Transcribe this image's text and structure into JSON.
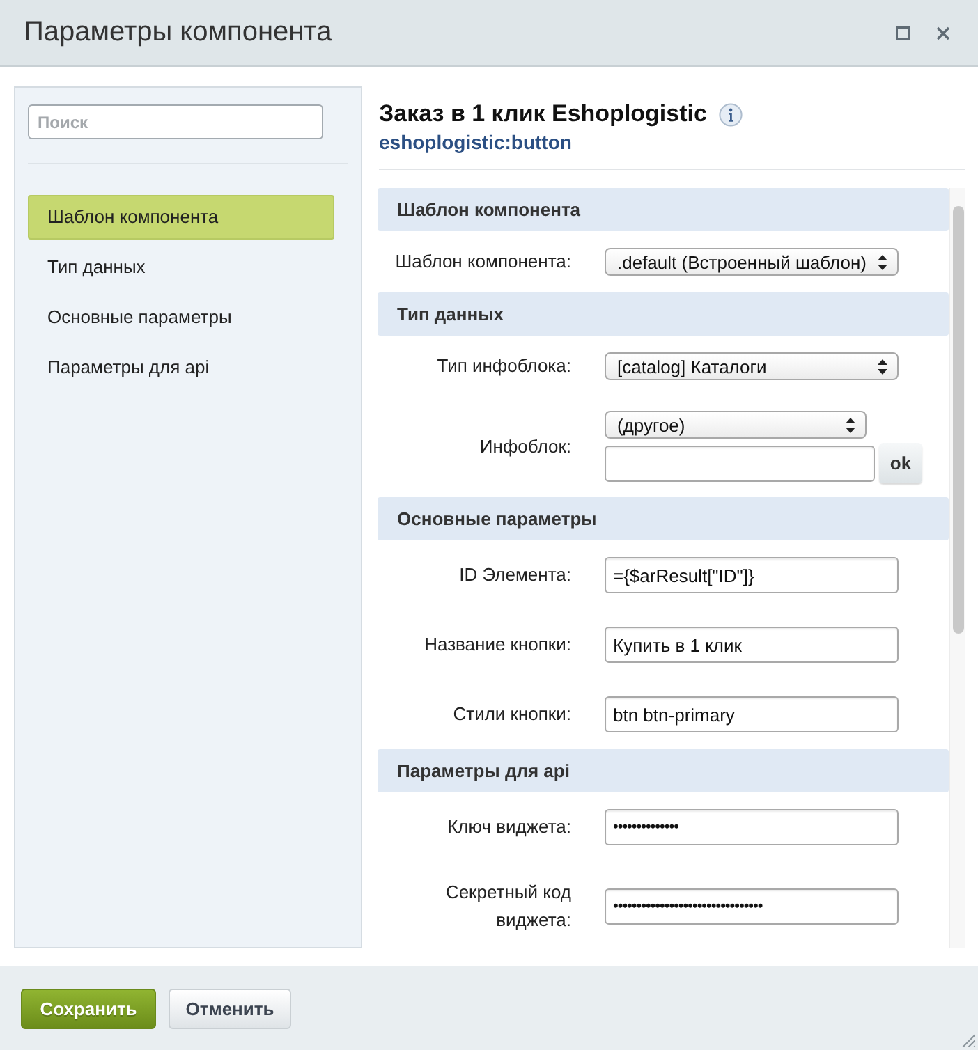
{
  "window": {
    "title": "Параметры компонента"
  },
  "sidebar": {
    "search": {
      "placeholder": "Поиск"
    },
    "items": [
      {
        "label": "Шаблон компонента",
        "selected": true
      },
      {
        "label": "Тип данных",
        "selected": false
      },
      {
        "label": "Основные параметры",
        "selected": false
      },
      {
        "label": "Параметры для api",
        "selected": false
      }
    ]
  },
  "component": {
    "title": "Заказ в 1 клик Eshoplogistic",
    "code": "eshoplogistic:button"
  },
  "sections": [
    {
      "title": "Шаблон компонента",
      "fields": [
        {
          "kind": "select",
          "label": "Шаблон компонента:",
          "value": ".default (Встроенный шаблон)"
        }
      ]
    },
    {
      "title": "Тип данных",
      "fields": [
        {
          "kind": "select",
          "label": "Тип инфоблока:",
          "value": "[catalog] Каталоги"
        },
        {
          "kind": "select_other",
          "label": "Инфоблок:",
          "value": "(другое)",
          "button": "ok"
        }
      ]
    },
    {
      "title": "Основные параметры",
      "fields": [
        {
          "kind": "text",
          "label": "ID Элемента:",
          "value": "={$arResult[\"ID\"]}"
        },
        {
          "kind": "text",
          "label": "Название кнопки:",
          "value": "Купить в 1 клик"
        },
        {
          "kind": "text",
          "label": "Стили кнопки:",
          "value": "btn btn-primary"
        }
      ]
    },
    {
      "title": "Параметры для api",
      "fields": [
        {
          "kind": "password",
          "label": "Ключ виджета:",
          "value": "••••••••••••••"
        },
        {
          "kind": "password",
          "label": "Секретный код виджета:",
          "value": "••••••••••••••••••••••••••••••••"
        }
      ]
    }
  ],
  "buttons": [
    {
      "kind": "primary",
      "label": "Сохранить"
    },
    {
      "kind": "secondary",
      "label": "Отменить"
    }
  ]
}
